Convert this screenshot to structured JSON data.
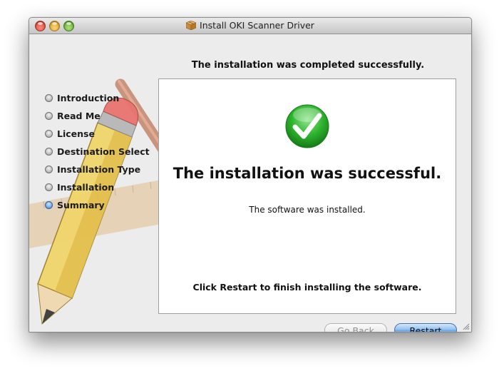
{
  "window": {
    "title": "Install OKI Scanner Driver",
    "title_icon": "package-icon"
  },
  "header": {
    "step_title": "The installation was completed successfully."
  },
  "sidebar": {
    "items": [
      {
        "label": "Introduction",
        "state": "done"
      },
      {
        "label": "Read Me",
        "state": "done"
      },
      {
        "label": "License",
        "state": "done"
      },
      {
        "label": "Destination Select",
        "state": "done"
      },
      {
        "label": "Installation Type",
        "state": "done"
      },
      {
        "label": "Installation",
        "state": "done"
      },
      {
        "label": "Summary",
        "state": "current"
      }
    ]
  },
  "main": {
    "status_icon": "checkmark-icon",
    "headline": "The installation was successful.",
    "detail": "The software was installed.",
    "instruction": "Click Restart to finish installing the software."
  },
  "buttons": {
    "back": {
      "label": "Go Back",
      "enabled": false
    },
    "restart": {
      "label": "Restart",
      "default": true
    }
  },
  "colors": {
    "accent_blue": "#6aa6e6",
    "success_green": "#2fb52f"
  }
}
